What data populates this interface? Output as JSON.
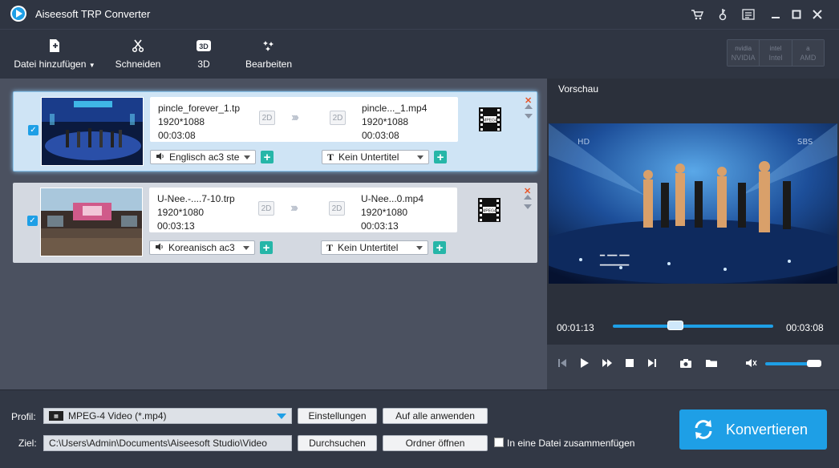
{
  "app": {
    "title": "Aiseesoft TRP Converter"
  },
  "titlebar_icons": [
    "cart-icon",
    "key-icon",
    "menu-list-icon",
    "minimize-icon",
    "maximize-icon",
    "close-icon"
  ],
  "toolbar": {
    "add_file": "Datei hinzufügen",
    "cut": "Schneiden",
    "threed": "3D",
    "edit": "Bearbeiten",
    "accel": [
      {
        "mini": "nvidia",
        "label": "NVIDIA"
      },
      {
        "mini": "intel",
        "label": "Intel"
      },
      {
        "mini": "a",
        "label": "AMD"
      }
    ]
  },
  "files": [
    {
      "src_name": "pincle_forever_1.tp",
      "src_res": "1920*1088",
      "src_dur": "00:03:08",
      "src_mode": "2D",
      "dst_mode": "2D",
      "dst_name": "pincle..._1.mp4",
      "dst_res": "1920*1088",
      "dst_dur": "00:03:08",
      "format": "MPEG4",
      "audio": "Englisch ac3 ste",
      "subtitle": "Kein Untertitel",
      "checked": true,
      "selected": true
    },
    {
      "src_name": "U-Nee.-....7-10.trp",
      "src_res": "1920*1080",
      "src_dur": "00:03:13",
      "src_mode": "2D",
      "dst_mode": "2D",
      "dst_name": "U-Nee...0.mp4",
      "dst_res": "1920*1080",
      "dst_dur": "00:03:13",
      "format": "MPEG4",
      "audio": "Koreanisch ac3",
      "subtitle": "Kein Untertitel",
      "checked": true,
      "selected": false
    }
  ],
  "preview": {
    "title": "Vorschau",
    "current_time": "00:01:13",
    "total_time": "00:03:08",
    "progress": 0.39,
    "volume": 0.8
  },
  "bottom": {
    "profile_label": "Profil:",
    "profile_value": "MPEG-4 Video (*.mp4)",
    "settings_btn": "Einstellungen",
    "apply_all_btn": "Auf alle anwenden",
    "dest_label": "Ziel:",
    "dest_path": "C:\\Users\\Admin\\Documents\\Aiseesoft Studio\\Video",
    "browse_btn": "Durchsuchen",
    "open_folder_btn": "Ordner öffnen",
    "merge_label": "In eine Datei zusammenfügen",
    "convert_btn": "Konvertieren"
  },
  "colors": {
    "accent": "#1e9fe6",
    "plus": "#26b6a8",
    "remove": "#e8572a"
  }
}
